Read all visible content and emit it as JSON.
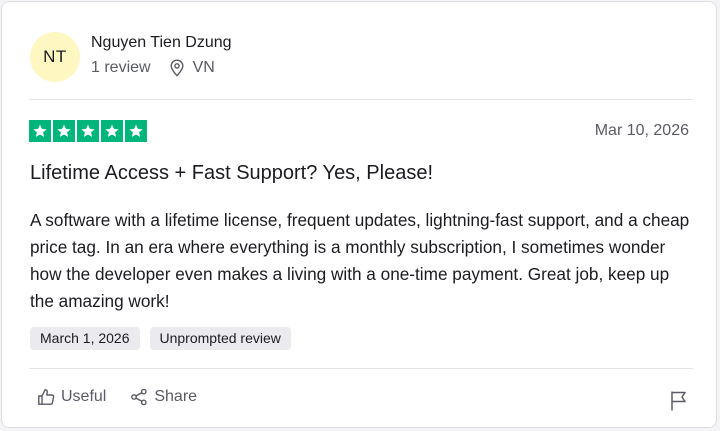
{
  "review": {
    "avatar_initials": "NT",
    "user_name": "Nguyen Tien Dzung",
    "review_count": "1 review",
    "location": "VN",
    "rating": 5,
    "rating_max": 5,
    "date": "Mar 10, 2026",
    "title": "Lifetime Access + Fast Support? Yes, Please!",
    "body": "A software with a lifetime license, frequent updates, lightning-fast support, and a cheap price tag. In an era where everything is a monthly subscription, I sometimes wonder how the developer even makes a living with a one-time payment. Great job, keep up the amazing work!",
    "tags": [
      "March 1, 2026",
      "Unprompted review"
    ],
    "actions": {
      "useful_label": "Useful",
      "share_label": "Share"
    },
    "icons": {
      "location": "location-pin-icon",
      "star": "star-icon",
      "useful": "thumbs-up-icon",
      "share": "share-icon",
      "report": "flag-icon"
    },
    "colors": {
      "star_fill": "#00b67a",
      "avatar_bg": "#fff7c2",
      "tag_bg": "#ebebef"
    }
  }
}
